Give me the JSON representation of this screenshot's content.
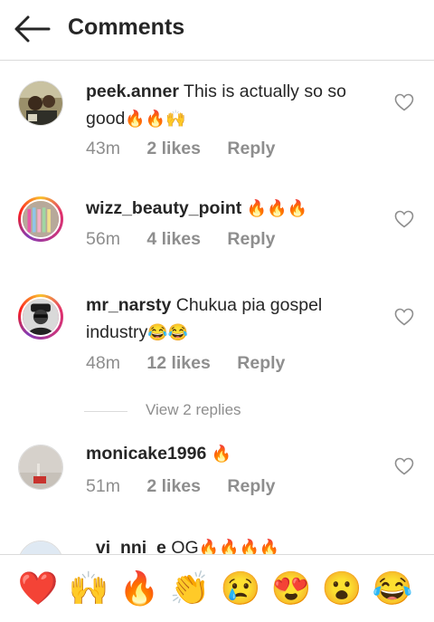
{
  "header": {
    "title": "Comments"
  },
  "comments": [
    {
      "username": "peek.anner",
      "text": "This is actually so so good",
      "emojis": "🔥🔥🙌",
      "time": "43m",
      "likes": "2 likes",
      "reply": "Reply"
    },
    {
      "username": "wizz_beauty_point",
      "text": "",
      "emojis": "🔥🔥🔥",
      "time": "56m",
      "likes": "4 likes",
      "reply": "Reply"
    },
    {
      "username": "mr_narsty",
      "text": "Chukua pia gospel industry",
      "emojis": "😂😂",
      "time": "48m",
      "likes": "12 likes",
      "reply": "Reply"
    },
    {
      "username": "monicake1996",
      "text": "",
      "emojis": "🔥",
      "time": "51m",
      "likes": "2 likes",
      "reply": "Reply"
    },
    {
      "username": "_vi_nni_e",
      "text": "OG",
      "emojis": "🔥🔥🔥🔥",
      "time": "",
      "likes": "",
      "reply": ""
    }
  ],
  "view_replies": {
    "label": "View 2 replies"
  },
  "quick_reactions": [
    "❤️",
    "🙌",
    "🔥",
    "👏",
    "😢",
    "😍",
    "😮",
    "😂"
  ],
  "icons": {
    "back": "arrow-left-icon",
    "like": "heart-outline-icon"
  },
  "colors": {
    "text": "#262626",
    "muted": "#8e8e8e",
    "divider": "#dbdbdb"
  }
}
